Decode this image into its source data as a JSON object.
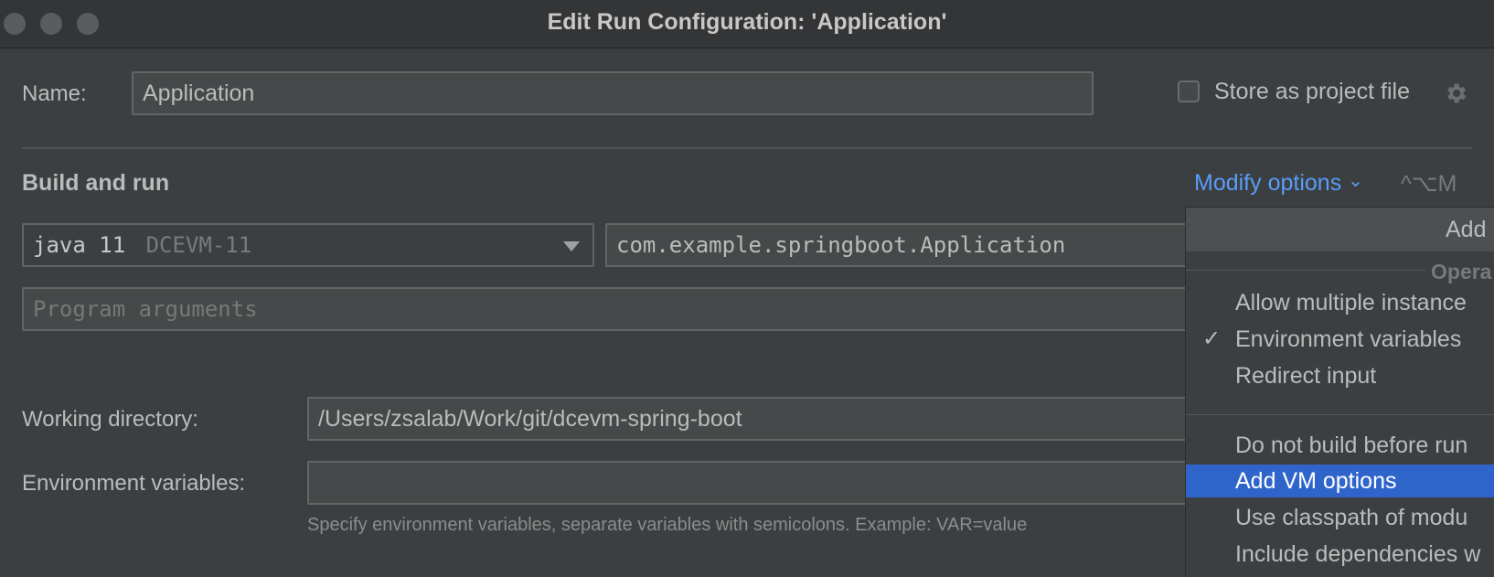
{
  "window": {
    "title": "Edit Run Configuration: 'Application'"
  },
  "name_row": {
    "label": "Name:",
    "value": "Application",
    "store_label": "Store as project file",
    "store_checked": false
  },
  "section": {
    "title": "Build and run",
    "modify_options": "Modify options",
    "modify_chevron": "⌄",
    "shortcut": "^⌥M"
  },
  "jdk": {
    "name": "java 11",
    "detail": "DCEVM-11"
  },
  "main_class": "com.example.springboot.Application",
  "program_args": {
    "placeholder": "Program arguments",
    "value": ""
  },
  "working_dir": {
    "label": "Working directory:",
    "value": "/Users/zsalab/Work/git/dcevm-spring-boot"
  },
  "env_vars": {
    "label": "Environment variables:",
    "value": "",
    "hint": "Specify environment variables, separate variables with semicolons. Example: VAR=value"
  },
  "popup": {
    "header": "Add",
    "group_title": "Opera",
    "items_group1": [
      {
        "label": "Allow multiple instance",
        "checked": false
      },
      {
        "label": "Environment variables",
        "checked": true
      },
      {
        "label": "Redirect input",
        "checked": false
      }
    ],
    "items_group2": [
      {
        "label": "Do not build before run",
        "selected": false
      },
      {
        "label": "Add VM options",
        "selected": true
      },
      {
        "label": "Use classpath of modu",
        "selected": false
      },
      {
        "label": "Include dependencies w",
        "selected": false
      }
    ],
    "check_glyph": "✓"
  }
}
